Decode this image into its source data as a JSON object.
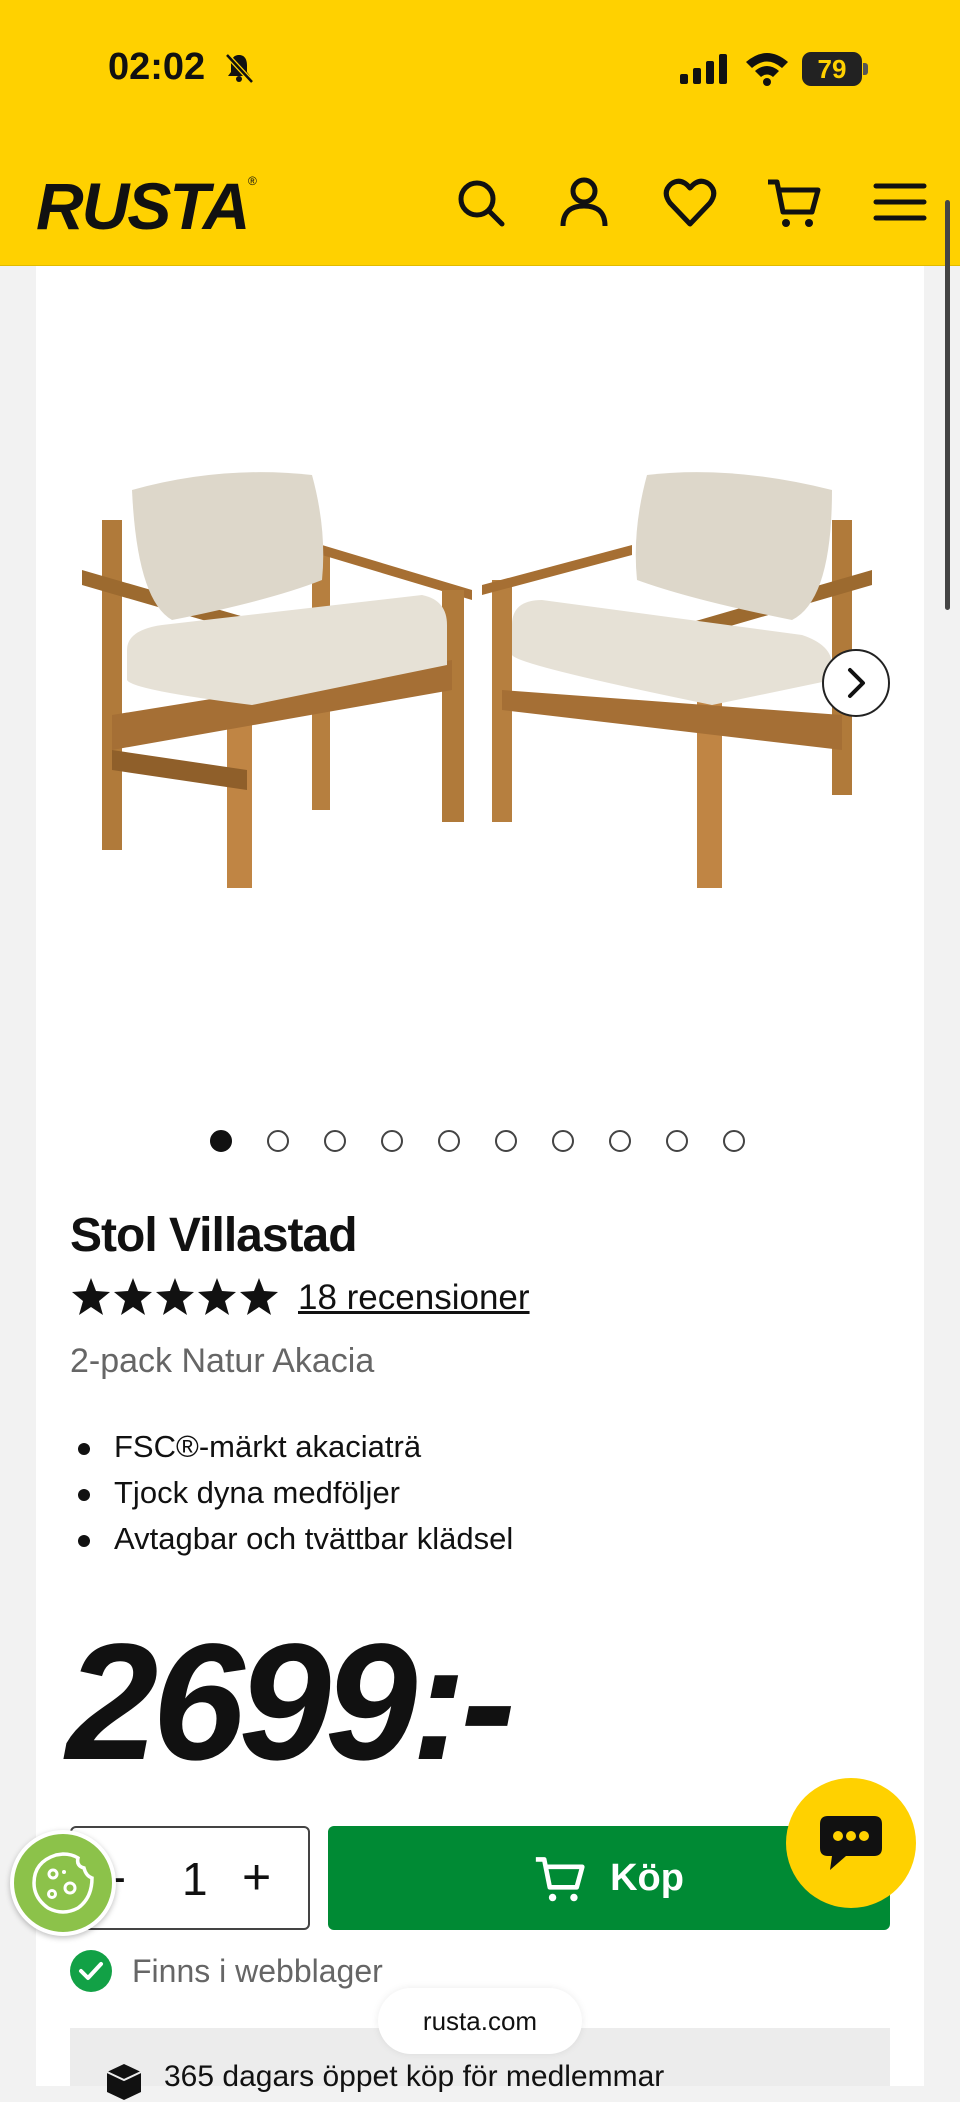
{
  "status_bar": {
    "time": "02:02",
    "battery": "79"
  },
  "header": {
    "logo": "RUSTA",
    "logo_mark": "®"
  },
  "gallery": {
    "dots": [
      1,
      2,
      3,
      4,
      5,
      6,
      7,
      8,
      9,
      10
    ],
    "active_index": 0
  },
  "product": {
    "title": "Stol Villastad",
    "rating_stars": 5,
    "reviews_label": "18 recensioner",
    "variant": "2-pack Natur Akacia",
    "features": [
      "FSC®-märkt akaciaträ",
      "Tjock dyna medföljer",
      "Avtagbar och tvättbar klädsel"
    ],
    "price": "2699:-"
  },
  "purchase": {
    "qty_minus": "-",
    "quantity": "1",
    "qty_plus": "+",
    "buy_label": "Köp"
  },
  "availability": {
    "web_stock": "Finns i webblager"
  },
  "browser": {
    "url": "rusta.com"
  },
  "info": {
    "open_purchase": "365 dagars öppet köp för medlemmar"
  },
  "colors": {
    "brand_yellow": "#ffd100",
    "buy_green": "#008a34",
    "stock_green": "#12a146"
  }
}
